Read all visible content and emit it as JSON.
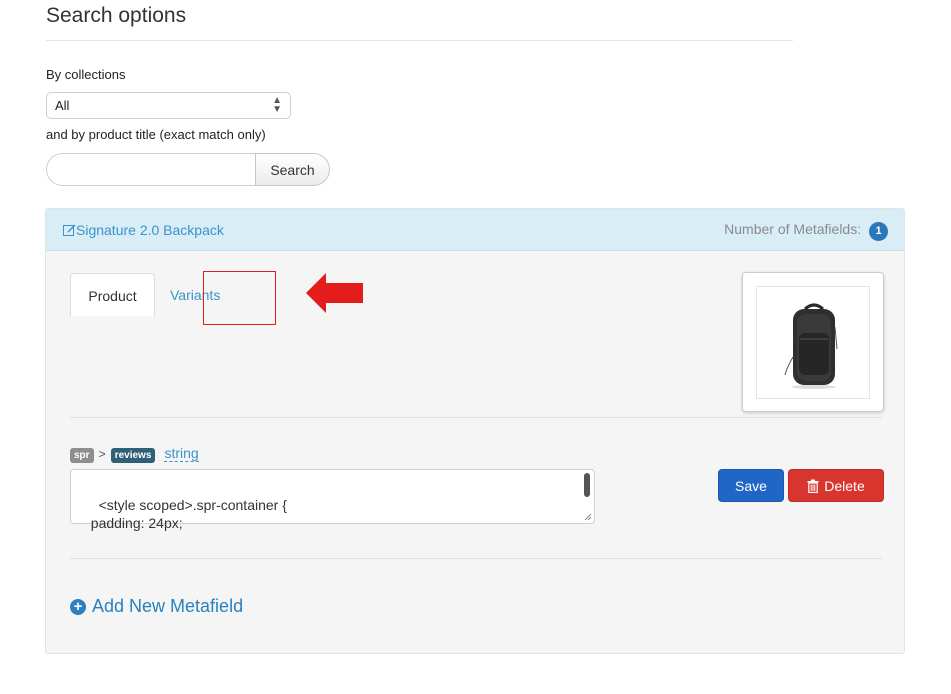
{
  "page": {
    "title": "Search options"
  },
  "filters": {
    "collections_label": "By collections",
    "collection_value": "All",
    "title_label": "and by product title (exact match only)",
    "search_placeholder": "",
    "search_button": "Search"
  },
  "product_panel": {
    "product_title": "Signature 2.0 Backpack",
    "metafields_label": "Number of Metafields:",
    "metafields_count": "1",
    "tabs": [
      {
        "label": "Product",
        "active": true
      },
      {
        "label": "Variants",
        "active": false
      }
    ],
    "image_alt": "black backpack"
  },
  "metafield": {
    "namespace": "spr",
    "separator": ">",
    "key": "reviews",
    "type": "string",
    "value": "<style scoped>.spr-container {\n  padding: 24px;",
    "save_label": "Save",
    "delete_label": "Delete"
  },
  "add_metafield_label": "Add New Metafield",
  "colors": {
    "accent_blue": "#3a93c8",
    "save_blue": "#1f66c6",
    "delete_red": "#d9352f",
    "panel_header": "#d9edf7",
    "annotation_red": "#e41c1c"
  }
}
